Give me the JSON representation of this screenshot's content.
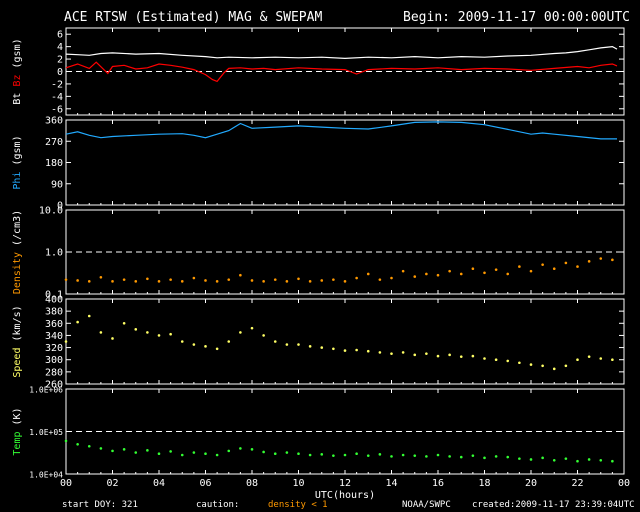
{
  "header": {
    "title": "ACE RTSW (Estimated) MAG & SWEPAM",
    "begin": "Begin: 2009-11-17 00:00:00UTC"
  },
  "footer": {
    "start_doy": "start DOY: 321",
    "caution": "caution:",
    "density_note": "density < 1",
    "source": "NOAA/SWPC",
    "created": "created:2009-11-17 23:39:04UTC"
  },
  "colors": {
    "bt": "#ffffff",
    "bz": "#ff0000",
    "phi": "#22aaff",
    "density": "#ff9900",
    "speed": "#ffff66",
    "temp": "#33ff33",
    "frame": "#ffffff",
    "dash": "#ffffff"
  },
  "chart_data": {
    "type": "scatter",
    "xlabel": "UTC(hours)",
    "x_ticks": [
      "00",
      "02",
      "04",
      "06",
      "08",
      "10",
      "12",
      "14",
      "16",
      "18",
      "20",
      "22",
      "00"
    ],
    "xlim": [
      0,
      24
    ],
    "panels": [
      {
        "id": "mag",
        "ylabel_parts": [
          {
            "text": "Bt",
            "color": "#ffffff"
          },
          {
            "text": "Bz",
            "color": "#ff0000"
          },
          {
            "text": "(gsm)",
            "color": "#ffffff"
          }
        ],
        "ylim": [
          -7,
          7
        ],
        "ticks": [
          "6",
          "4",
          "2",
          "0",
          "-2",
          "-4",
          "-6"
        ],
        "tick_values": [
          6,
          4,
          2,
          0,
          -2,
          -4,
          -6
        ],
        "dashed_at": 0,
        "series": [
          {
            "name": "Bt",
            "style": "line",
            "color": "#ffffff",
            "x": [
              0,
              0.5,
              1,
              1.5,
              2,
              3,
              4,
              5,
              6,
              6.5,
              7,
              8,
              9,
              10,
              11,
              12,
              13,
              14,
              15,
              16,
              17,
              18,
              19,
              20,
              21,
              21.5,
              22,
              22.5,
              23,
              23.5,
              23.7
            ],
            "y": [
              2.8,
              2.7,
              2.6,
              2.9,
              3.0,
              2.8,
              2.9,
              2.6,
              2.4,
              2.2,
              2.3,
              2.2,
              2.3,
              2.2,
              2.3,
              2.1,
              2.3,
              2.2,
              2.4,
              2.2,
              2.4,
              2.3,
              2.5,
              2.6,
              2.9,
              3.0,
              3.2,
              3.5,
              3.8,
              4.0,
              3.6
            ]
          },
          {
            "name": "Bz",
            "style": "line",
            "color": "#ff0000",
            "x": [
              0,
              0.5,
              1,
              1.3,
              1.8,
              2,
              2.5,
              3,
              3.5,
              4,
              4.5,
              5,
              5.5,
              6,
              6.3,
              6.5,
              6.8,
              7,
              7.5,
              8,
              8.5,
              9,
              10,
              11,
              12,
              12.5,
              13,
              14,
              15,
              16,
              17,
              18,
              19,
              20,
              21,
              22,
              22.5,
              23,
              23.5,
              23.7
            ],
            "y": [
              0.6,
              1.2,
              0.5,
              1.5,
              -0.3,
              0.8,
              1.0,
              0.4,
              0.6,
              1.2,
              1.0,
              0.7,
              0.3,
              -0.5,
              -1.3,
              -1.6,
              -0.2,
              0.5,
              0.6,
              0.4,
              0.5,
              0.3,
              0.6,
              0.4,
              0.3,
              -0.4,
              0.3,
              0.5,
              0.4,
              0.6,
              0.3,
              0.5,
              0.4,
              0.2,
              0.5,
              0.8,
              0.6,
              1.0,
              1.2,
              0.9
            ]
          }
        ]
      },
      {
        "id": "phi",
        "ylabel_parts": [
          {
            "text": "Phi",
            "color": "#22aaff"
          },
          {
            "text": "(gsm)",
            "color": "#ffffff"
          }
        ],
        "ylim": [
          0,
          360
        ],
        "ticks": [
          "360",
          "270",
          "180",
          "90",
          "0"
        ],
        "tick_values": [
          360,
          270,
          180,
          90,
          0
        ],
        "series": [
          {
            "name": "Phi",
            "style": "line",
            "color": "#22aaff",
            "x": [
              0,
              0.5,
              1,
              1.5,
              2,
              3,
              4,
              5,
              5.5,
              6,
              6.5,
              7,
              7.5,
              8,
              9,
              10,
              11,
              12,
              13,
              14,
              15,
              16,
              17,
              18,
              19,
              20,
              20.5,
              21,
              22,
              23,
              23.7
            ],
            "y": [
              300,
              310,
              295,
              285,
              290,
              295,
              300,
              302,
              295,
              285,
              300,
              315,
              345,
              325,
              330,
              335,
              330,
              325,
              322,
              335,
              350,
              352,
              350,
              340,
              320,
              300,
              305,
              300,
              290,
              280,
              280
            ]
          }
        ]
      },
      {
        "id": "density",
        "ylabel_parts": [
          {
            "text": "Density",
            "color": "#ff9900"
          },
          {
            "text": "(/cm3)",
            "color": "#ffffff"
          }
        ],
        "ylim": [
          0.1,
          10
        ],
        "log": true,
        "ticks": [
          "10.0",
          "1.0",
          "0.1"
        ],
        "tick_values": [
          10,
          1,
          0.1
        ],
        "dashed_at": 1,
        "series": [
          {
            "name": "Density",
            "style": "points",
            "color": "#ff9900",
            "x": [
              0,
              0.5,
              1,
              1.5,
              2,
              2.5,
              3,
              3.5,
              4,
              4.5,
              5,
              5.5,
              6,
              6.5,
              7,
              7.5,
              8,
              8.5,
              9,
              9.5,
              10,
              10.5,
              11,
              11.5,
              12,
              12.5,
              13,
              13.5,
              14,
              14.5,
              15,
              15.5,
              16,
              16.5,
              17,
              17.5,
              18,
              18.5,
              19,
              19.5,
              20,
              20.5,
              21,
              21.5,
              22,
              22.5,
              23,
              23.5
            ],
            "y": [
              0.22,
              0.21,
              0.2,
              0.25,
              0.2,
              0.22,
              0.2,
              0.23,
              0.2,
              0.22,
              0.2,
              0.24,
              0.21,
              0.2,
              0.22,
              0.28,
              0.21,
              0.2,
              0.22,
              0.2,
              0.23,
              0.2,
              0.21,
              0.22,
              0.2,
              0.24,
              0.3,
              0.22,
              0.24,
              0.35,
              0.26,
              0.3,
              0.28,
              0.35,
              0.3,
              0.4,
              0.32,
              0.38,
              0.3,
              0.45,
              0.35,
              0.5,
              0.4,
              0.55,
              0.45,
              0.6,
              0.7,
              0.65
            ]
          }
        ]
      },
      {
        "id": "speed",
        "ylabel_parts": [
          {
            "text": "Speed",
            "color": "#ffff66"
          },
          {
            "text": "(km/s)",
            "color": "#ffffff"
          }
        ],
        "ylim": [
          260,
          400
        ],
        "ticks": [
          "400",
          "380",
          "360",
          "340",
          "320",
          "300",
          "280",
          "260"
        ],
        "tick_values": [
          400,
          380,
          360,
          340,
          320,
          300,
          280,
          260
        ],
        "series": [
          {
            "name": "Speed",
            "style": "points",
            "color": "#ffff66",
            "x": [
              0,
              0.5,
              1,
              1.5,
              2,
              2.5,
              3,
              3.5,
              4,
              4.5,
              5,
              5.5,
              6,
              6.5,
              7,
              7.5,
              8,
              8.5,
              9,
              9.5,
              10,
              10.5,
              11,
              11.5,
              12,
              12.5,
              13,
              13.5,
              14,
              14.5,
              15,
              15.5,
              16,
              16.5,
              17,
              17.5,
              18,
              18.5,
              19,
              19.5,
              20,
              20.5,
              21,
              21.5,
              22,
              22.5,
              23,
              23.5
            ],
            "y": [
              330,
              362,
              372,
              345,
              335,
              360,
              350,
              345,
              340,
              342,
              330,
              325,
              322,
              318,
              330,
              345,
              352,
              340,
              330,
              325,
              325,
              322,
              320,
              318,
              315,
              316,
              314,
              312,
              310,
              312,
              308,
              310,
              306,
              308,
              305,
              306,
              302,
              300,
              298,
              295,
              292,
              290,
              285,
              290,
              300,
              305,
              302,
              300
            ]
          }
        ]
      },
      {
        "id": "temp",
        "ylabel_parts": [
          {
            "text": "Temp",
            "color": "#33ff33"
          },
          {
            "text": "(K)",
            "color": "#ffffff"
          }
        ],
        "ylim": [
          10000,
          1000000
        ],
        "log": true,
        "ticks": [
          "1.0E+06",
          "1.0E+05",
          "1.0E+04"
        ],
        "tick_values": [
          1000000,
          100000,
          10000
        ],
        "dashed_at": 100000,
        "series": [
          {
            "name": "Temp",
            "style": "points",
            "color": "#33ff33",
            "x": [
              0,
              0.5,
              1,
              1.5,
              2,
              2.5,
              3,
              3.5,
              4,
              4.5,
              5,
              5.5,
              6,
              6.5,
              7,
              7.5,
              8,
              8.5,
              9,
              9.5,
              10,
              10.5,
              11,
              11.5,
              12,
              12.5,
              13,
              13.5,
              14,
              14.5,
              15,
              15.5,
              16,
              16.5,
              17,
              17.5,
              18,
              18.5,
              19,
              19.5,
              20,
              20.5,
              21,
              21.5,
              22,
              22.5,
              23,
              23.5
            ],
            "y": [
              60000,
              50000,
              45000,
              40000,
              35000,
              38000,
              32000,
              36000,
              30000,
              34000,
              28000,
              32000,
              30000,
              28000,
              35000,
              40000,
              38000,
              33000,
              30000,
              32000,
              30000,
              28000,
              29000,
              27000,
              28000,
              30000,
              27000,
              29000,
              26000,
              28000,
              27000,
              26000,
              28000,
              26000,
              25000,
              27000,
              24000,
              26000,
              25000,
              23000,
              22000,
              24000,
              21000,
              23000,
              20000,
              22000,
              21000,
              20000
            ]
          }
        ]
      }
    ]
  }
}
